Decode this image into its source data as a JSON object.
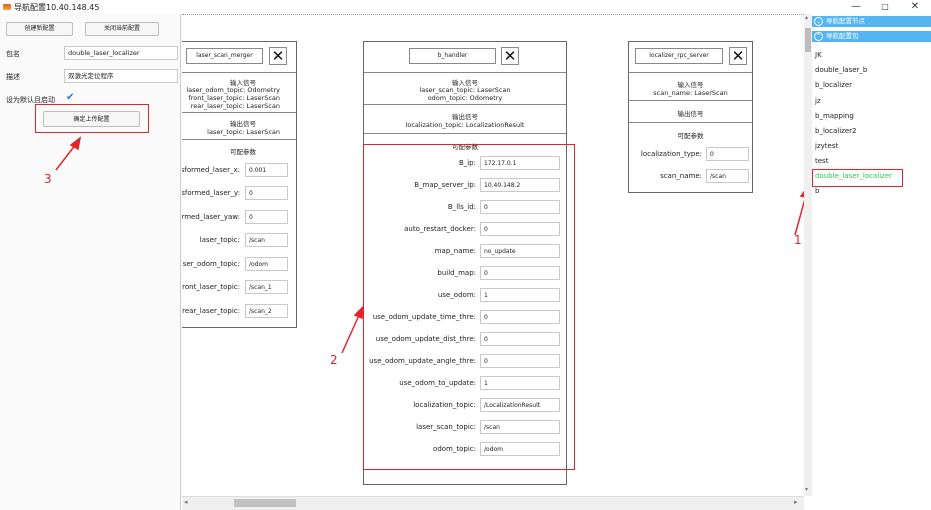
{
  "window": {
    "title": "导航配置10.40.148.45",
    "controls": [
      "—",
      "□",
      "✕"
    ]
  },
  "left_panel": {
    "create_button": "创建新配置",
    "close_button": "关闭当前配置",
    "package_label": "包名",
    "package_value": "double_laser_localizer",
    "desc_label": "描述",
    "desc_value": "双激光定位程序",
    "default_label": "设为默认且启动",
    "default_checked": "✔",
    "upload_button": "确定上传配置"
  },
  "nodes": {
    "laser_scan_merger": {
      "name": "laser_scan_merger",
      "input_title": "输入信号",
      "inputs": [
        "laser_odom_topic: Odometry",
        "front_laser_topic: LaserScan",
        "rear_laser_topic: LaserScan"
      ],
      "output_title": "输出信号",
      "outputs": [
        "laser_topic: LaserScan"
      ],
      "params_title": "可配参数",
      "params": [
        {
          "label": "transformed_laser_x:",
          "value": "0.001"
        },
        {
          "label": "transformed_laser_y:",
          "value": "0"
        },
        {
          "label": "transformed_laser_yaw:",
          "value": "0"
        },
        {
          "label": "laser_topic:",
          "value": "/scan"
        },
        {
          "label": "laser_odom_topic:",
          "value": "/odom"
        },
        {
          "label": "front_laser_topic:",
          "value": "/scan_1"
        },
        {
          "label": "rear_laser_topic:",
          "value": "/scan_2"
        }
      ]
    },
    "b_handler": {
      "name": "b_handler",
      "input_title": "输入信号",
      "inputs": [
        "laser_scan_topic: LaserScan",
        "odom_topic: Odometry"
      ],
      "output_title": "输出信号",
      "outputs": [
        "localization_topic: LocalizationResult"
      ],
      "params_title": "可配参数",
      "params": [
        {
          "label": "B_ip:",
          "value": "172.17.0.1"
        },
        {
          "label": "B_map_server_ip:",
          "value": "10.40.148.2"
        },
        {
          "label": "B_lls_id:",
          "value": "0"
        },
        {
          "label": "auto_restart_docker:",
          "value": "0"
        },
        {
          "label": "map_name:",
          "value": "no_update"
        },
        {
          "label": "build_map:",
          "value": "0"
        },
        {
          "label": "use_odom:",
          "value": "1"
        },
        {
          "label": "use_odom_update_time_thre:",
          "value": "0"
        },
        {
          "label": "use_odom_update_dist_thre:",
          "value": "0"
        },
        {
          "label": "use_odom_update_angle_thre:",
          "value": "0"
        },
        {
          "label": "use_odom_to_update:",
          "value": "1"
        },
        {
          "label": "localization_topic:",
          "value": "/LocalizationResult"
        },
        {
          "label": "laser_scan_topic:",
          "value": "/scan"
        },
        {
          "label": "odom_topic:",
          "value": "/odom"
        }
      ]
    },
    "localizer_rpc_server": {
      "name": "localizer_rpc_server",
      "input_title": "输入信号",
      "inputs": [
        "scan_name: LaserScan"
      ],
      "output_title": "输出信号",
      "outputs": [],
      "params_title": "可配参数",
      "params": [
        {
          "label": "localization_type:",
          "value": "0"
        },
        {
          "label": "scan_name:",
          "value": "/scan"
        }
      ]
    }
  },
  "right_panel": {
    "nodes_header": "导航配置节点",
    "nodes_header_icon": "⌄",
    "packages_header": "导航配置包",
    "packages_header_icon": "⌃",
    "packages": [
      "JK",
      "double_laser_b",
      "b_localizer",
      "jz",
      "b_mapping",
      "b_localizer2",
      "jzytest",
      "test",
      "double_laser_localizer",
      "b"
    ],
    "selected_package": "double_laser_localizer"
  },
  "annotations": {
    "one": "1",
    "two": "2",
    "three": "3",
    "color": "#e0262b"
  },
  "colors": {
    "accent": "#55b5f2",
    "selected_text": "#3ec24a",
    "checkbox": "#2b6fd1"
  }
}
